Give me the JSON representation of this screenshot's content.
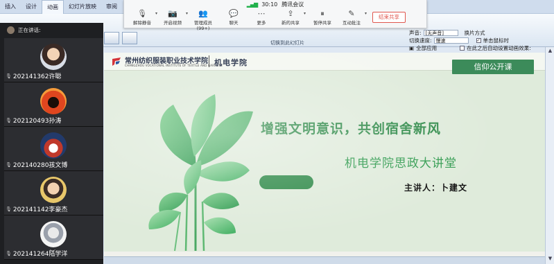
{
  "ppt": {
    "tabs": [
      "插入",
      "设计",
      "动画",
      "幻灯片放映",
      "审阅",
      "视图"
    ],
    "active_tab_index": 2,
    "group_label": "切换到此幻灯片",
    "sound_label": "声音:",
    "sound_value": "[无声音]",
    "advance_label": "换片方式",
    "speed_label": "切换速度:",
    "speed_value": "慢速",
    "on_click_label": "单击鼠标时",
    "apply_all_label": "全部应用",
    "auto_after_label": "在此之后自动设置动画效果:",
    "on_click_checked": true
  },
  "meeting": {
    "timer": "30:10",
    "app_name": "腾讯会议",
    "tools": [
      {
        "label": "解除静音",
        "icon": "microphone-muted-icon",
        "glyph": "🎙",
        "has_caret": true
      },
      {
        "label": "开启视频",
        "icon": "camera-off-icon",
        "glyph": "📷",
        "has_caret": true
      },
      {
        "label": "管理成员(99+)",
        "icon": "members-icon",
        "glyph": "👥",
        "has_caret": false
      },
      {
        "label": "聊天",
        "icon": "chat-icon",
        "glyph": "💬",
        "has_caret": false
      },
      {
        "label": "更多",
        "icon": "more-icon",
        "glyph": "⋯",
        "has_caret": false
      },
      {
        "label": "新的共享",
        "icon": "share-icon",
        "glyph": "⇪",
        "has_caret": true
      },
      {
        "label": "暂停共享",
        "icon": "pause-icon",
        "glyph": "⏸",
        "has_caret": false
      },
      {
        "label": "互动批注",
        "icon": "annotate-icon",
        "glyph": "✎",
        "has_caret": true
      }
    ],
    "end_share_label": "结束共享"
  },
  "participants": {
    "speaking_label": "正在讲话:",
    "list": [
      {
        "name": "202141362许聪"
      },
      {
        "name": "202120493孙涛"
      },
      {
        "name": "202140280孩文博"
      },
      {
        "name": "202141142李豪杰"
      },
      {
        "name": "202141264陆学洋"
      }
    ]
  },
  "slide": {
    "school_name": "常州纺织服装职业技术学院",
    "school_name_en": "CHANGZHOU VOCATIONAL INSTITUTE OF TEXTILE AND GARMENT",
    "college": "机电学院",
    "badge": "信仰公开课",
    "title": "增强文明意识，共创宿舍新风",
    "subtitle": "机电学院思政大讲堂",
    "speaker": "主讲人：卜建文"
  },
  "colors": {
    "slide_bg": "#dfebdb",
    "accent_green": "#2f8a49",
    "end_share_red": "#e0564e",
    "panel_dark": "#1e1f22"
  }
}
